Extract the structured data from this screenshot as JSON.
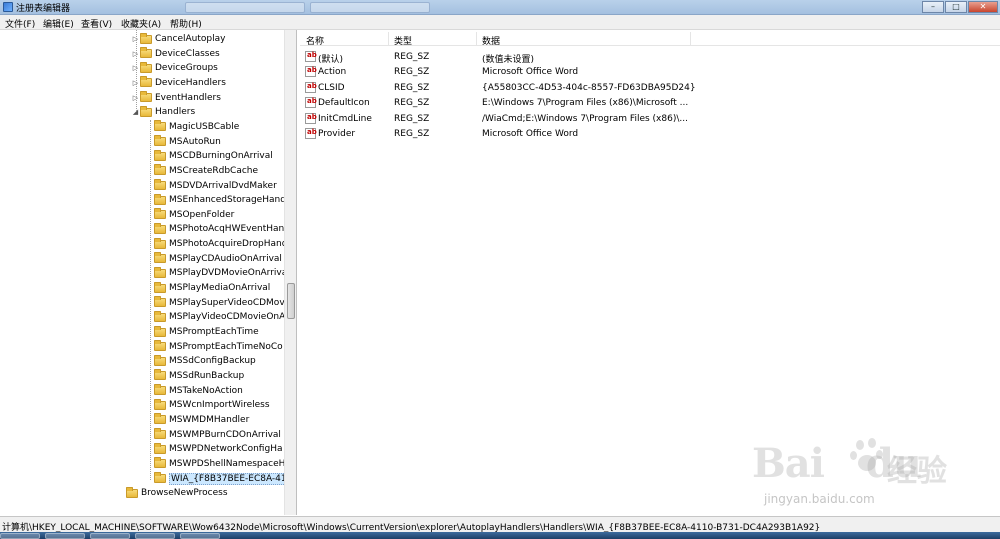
{
  "window": {
    "title": "注册表编辑器",
    "buttons": {
      "minimize": "–",
      "maximize": "□",
      "close": "✕"
    }
  },
  "menu": [
    "文件(F)",
    "编辑(E)",
    "查看(V)",
    "收藏夹(A)",
    "帮助(H)"
  ],
  "tree": {
    "top_nodes": [
      "CancelAutoplay",
      "DeviceClasses",
      "DeviceGroups",
      "DeviceHandlers",
      "EventHandlers"
    ],
    "handlers_label": "Handlers",
    "handlers_children": [
      "MagicUSBCable",
      "MSAutoRun",
      "MSCDBurningOnArrival",
      "MSCreateRdbCache",
      "MSDVDArrivalDvdMaker",
      "MSEnhancedStorageHand",
      "MSOpenFolder",
      "MSPhotoAcqHWEventHand",
      "MSPhotoAcquireDropHand",
      "MSPlayCDAudioOnArrival",
      "MSPlayDVDMovieOnArriva",
      "MSPlayMediaOnArrival",
      "MSPlaySuperVideoCDMov",
      "MSPlayVideoCDMovieOnA",
      "MSPromptEachTime",
      "MSPromptEachTimeNoCo",
      "MSSdConfigBackup",
      "MSSdRunBackup",
      "MSTakeNoAction",
      "MSWcnImportWireless",
      "MSWMDMHandler",
      "MSWMPBurnCDOnArrival",
      "MSWPDNetworkConfigHa",
      "MSWPDShellNamespaceH",
      "WIA_{F8B37BEE-EC8A-411"
    ],
    "selected": "WIA_{F8B37BEE-EC8A-411",
    "bottom_node": "BrowseNewProcess"
  },
  "values": {
    "columns": {
      "name": "名称",
      "type": "类型",
      "data": "数据"
    },
    "rows": [
      {
        "name": "(默认)",
        "type": "REG_SZ",
        "data": "(数值未设置)"
      },
      {
        "name": "Action",
        "type": "REG_SZ",
        "data": "Microsoft Office Word"
      },
      {
        "name": "CLSID",
        "type": "REG_SZ",
        "data": "{A55803CC-4D53-404c-8557-FD63DBA95D24}"
      },
      {
        "name": "DefaultIcon",
        "type": "REG_SZ",
        "data": "E:\\Windows 7\\Program Files (x86)\\Microsoft ..."
      },
      {
        "name": "InitCmdLine",
        "type": "REG_SZ",
        "data": "/WiaCmd;E:\\Windows 7\\Program Files (x86)\\..."
      },
      {
        "name": "Provider",
        "type": "REG_SZ",
        "data": "Microsoft Office Word"
      }
    ]
  },
  "status": {
    "path": "计算机\\HKEY_LOCAL_MACHINE\\SOFTWARE\\Wow6432Node\\Microsoft\\Windows\\CurrentVersion\\explorer\\AutoplayHandlers\\Handlers\\WIA_{F8B37BEE-EC8A-4110-B731-DC4A293B1A92}"
  },
  "watermark": {
    "brand": "Bai",
    "brand2": "du",
    "cn": "经验",
    "url": "jingyan.baidu.com"
  }
}
